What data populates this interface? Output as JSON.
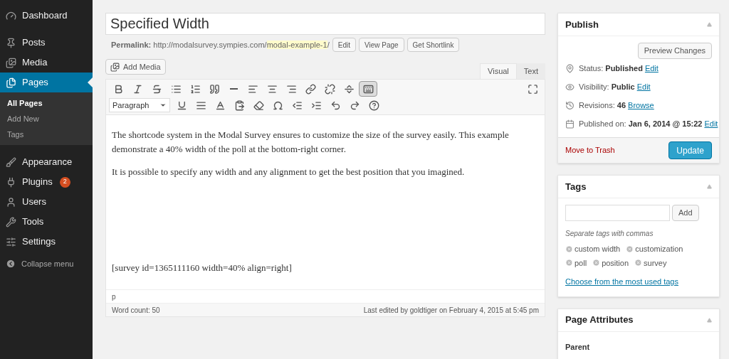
{
  "sidebar": {
    "items": [
      {
        "label": "Dashboard",
        "selected": false
      },
      {
        "label": "Posts",
        "selected": false
      },
      {
        "label": "Media",
        "selected": false
      },
      {
        "label": "Pages",
        "selected": true,
        "children": [
          {
            "label": "All Pages",
            "selected": true
          },
          {
            "label": "Add New",
            "selected": false
          },
          {
            "label": "Tags",
            "selected": false
          }
        ]
      },
      {
        "label": "Appearance",
        "selected": false
      },
      {
        "label": "Plugins",
        "selected": false,
        "badge": "2"
      },
      {
        "label": "Users",
        "selected": false
      },
      {
        "label": "Tools",
        "selected": false
      },
      {
        "label": "Settings",
        "selected": false
      }
    ],
    "collapse": "Collapse menu"
  },
  "editor": {
    "title": "Specified Width",
    "permalink": {
      "label": "Permalink:",
      "base": "http://modalsurvey.sympies.com/",
      "slug": "modal-example-1",
      "trail": "/",
      "buttons": [
        "Edit",
        "View Page",
        "Get Shortlink"
      ]
    },
    "add_media": "Add Media",
    "tabs": [
      {
        "label": "Visual",
        "selected": true
      },
      {
        "label": "Text",
        "selected": false
      }
    ],
    "toolbar": {
      "toggle_pressed": true,
      "format": "Paragraph"
    },
    "paragraphs": [
      "The shortcode system in the Modal Survey ensures to customize the size of the survey easily. This example demonstrate a 40% width of the poll at the bottom-right corner.",
      "It is possible to specify any width and any alignment to get the best position that you imagined.",
      "[survey id=1365111160 width=40% align=right]"
    ],
    "path": "p",
    "word_count": "Word count: 50",
    "last_edited": "Last edited by goldtiger on February 4, 2015 at 5:45 pm"
  },
  "publish": {
    "title": "Publish",
    "preview": "Preview Changes",
    "rows": [
      {
        "label": "Status:",
        "value": "Published",
        "link": "Edit"
      },
      {
        "label": "Visibility:",
        "value": "Public",
        "link": "Edit"
      },
      {
        "label": "Revisions:",
        "value": "46",
        "link": "Browse"
      },
      {
        "label": "Published on:",
        "value": "Jan 6, 2014 @ 15:22",
        "link": "Edit"
      }
    ],
    "trash": "Move to Trash",
    "update": "Update"
  },
  "tags": {
    "title": "Tags",
    "add": "Add",
    "hint": "Separate tags with commas",
    "items": [
      "custom width",
      "customization",
      "poll",
      "position",
      "survey"
    ],
    "choose": "Choose from the most used tags"
  },
  "page_attributes": {
    "title": "Page Attributes",
    "parent": "Parent"
  }
}
